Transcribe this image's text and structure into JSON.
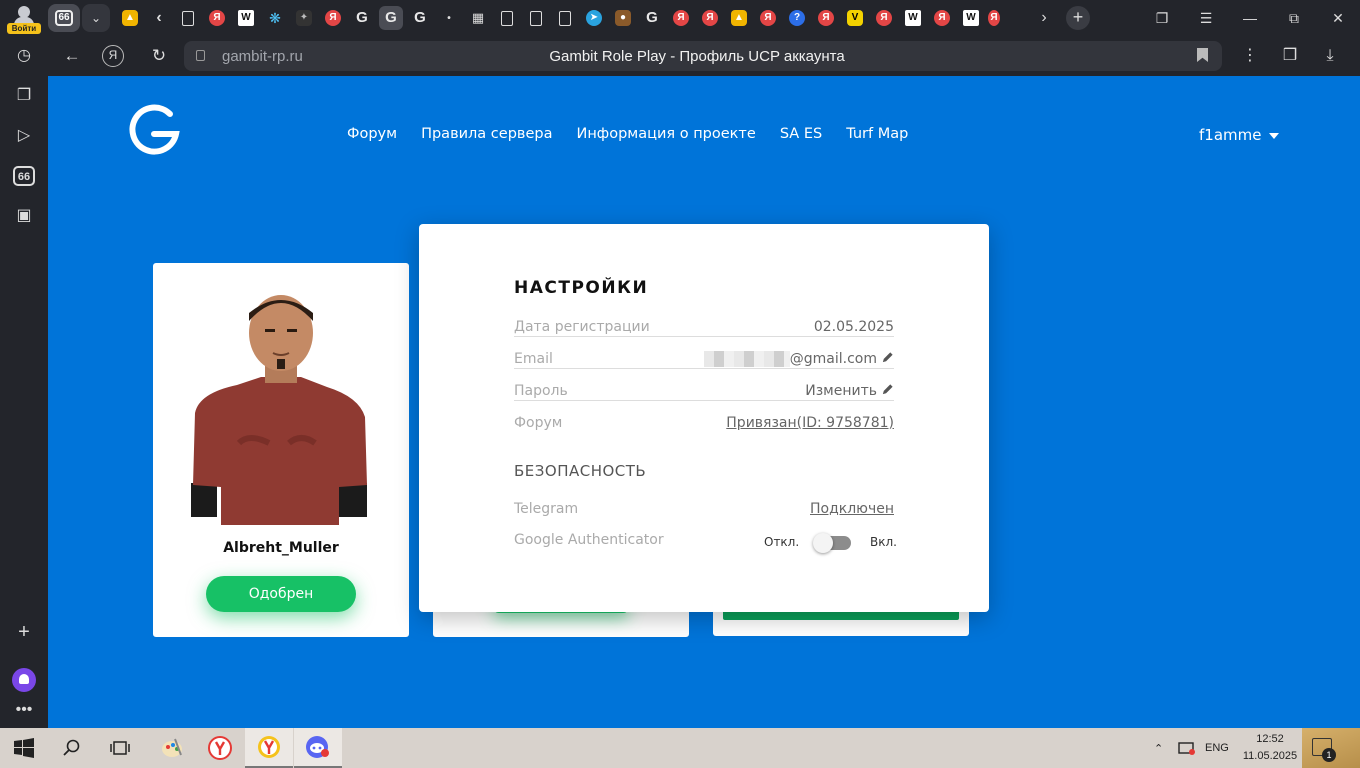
{
  "browser": {
    "profile_label": "Войти",
    "active_tab_badge": "66",
    "tab_icons": [
      "image",
      "chevron",
      "doc",
      "yandex",
      "wiki",
      "spark",
      "puzzle",
      "yandex",
      "gambit",
      "gambit",
      "gambit",
      "dot",
      "grid",
      "doc",
      "doc",
      "doc",
      "telegram",
      "photo",
      "gambit",
      "yandex",
      "yandex",
      "image",
      "yandex",
      "question",
      "yandex",
      "V",
      "yandex",
      "wiki",
      "yandex",
      "wiki",
      "yandex"
    ],
    "url_domain": "gambit-rp.ru",
    "page_title": "Gambit Role Play - Профиль UCP аккаунта"
  },
  "sidebar": {
    "badge": "66"
  },
  "site": {
    "nav": [
      "Форум",
      "Правила сервера",
      "Информация о проекте",
      "SA ES",
      "Turf Map"
    ],
    "username": "f1amme"
  },
  "character": {
    "name": "Albreht_Muller",
    "status_button": "Одобрен"
  },
  "settings": {
    "title": "НАСТРОЙКИ",
    "rows": [
      {
        "label": "Дата регистрации",
        "value": "02.05.2025"
      },
      {
        "label": "Email",
        "value": "@gmail.com"
      },
      {
        "label": "Пароль",
        "value": "Изменить"
      },
      {
        "label": "Форум",
        "value": "Привязан(ID: 9758781)"
      }
    ],
    "security_title": "БЕЗОПАСНОСТЬ",
    "telegram": {
      "label": "Telegram",
      "value": "Подключен"
    },
    "google_auth": {
      "label": "Google Authenticator",
      "off": "Откл.",
      "on": "Вкл.",
      "enabled": false
    }
  },
  "taskbar": {
    "language": "ENG",
    "time": "12:52",
    "date": "11.05.2025",
    "notifications": "1"
  },
  "colors": {
    "page_bg": "#0074d9",
    "approved_green": "#17c166",
    "browser_chrome": "#23252b"
  }
}
